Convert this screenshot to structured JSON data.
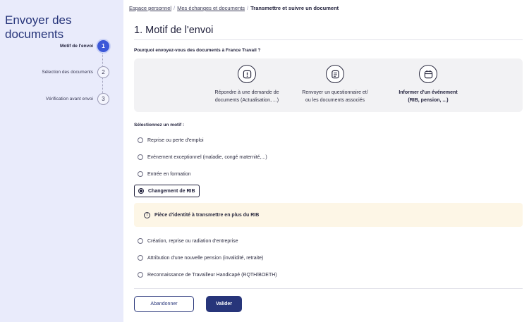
{
  "sidebar": {
    "title": "Envoyer des documents",
    "steps": [
      {
        "label": "Motif de l'envoi",
        "number": "1",
        "active": true
      },
      {
        "label": "Sélection des documents",
        "number": "2",
        "active": false
      },
      {
        "label": "Vérification avant envoi",
        "number": "3",
        "active": false
      }
    ]
  },
  "breadcrumb": {
    "items": [
      "Espace personnel",
      "Mes échanges et documents"
    ],
    "separator": "/",
    "current": "Transmettre et suivre un document"
  },
  "page": {
    "title": "1. Motif de l'envoi",
    "question": "Pourquoi envoyez-vous des documents à France Travail ?"
  },
  "cards": [
    {
      "icon": "alert-icon",
      "line1": "Répondre à une demande de",
      "line2": "documents (Actualisation, ...)",
      "selected": false
    },
    {
      "icon": "document-icon",
      "line1": "Renvoyer un questionnaire et/",
      "line2": "ou les documents associés",
      "selected": false
    },
    {
      "icon": "calendar-icon",
      "line1": "Informer d'un événement",
      "line2": "(RIB, pension, ...)",
      "selected": true
    }
  ],
  "motifs": {
    "label": "Sélectionnez un motif :",
    "options": [
      "Reprise ou perte d'emploi",
      "Evénement exceptionnel (maladie, congé maternité,...)",
      "Entrée en formation",
      "Changement de RIB",
      "Création, reprise ou radiation d'entreprise",
      "Attribution d'une nouvelle pension (invalidité, retraite)",
      "Reconnaissance de Travailleur Handicapé (RQTH/BOETH)"
    ],
    "selected": "Changement de RIB"
  },
  "warning": {
    "icon": "warning-icon",
    "text": "Pièce d'identité à transmettre en plus du RIB"
  },
  "actions": {
    "cancel_label": "Abandonner",
    "submit_label": "Valider"
  },
  "colors": {
    "sidebar_bg": "#e9ebfb",
    "accent": "#27357a",
    "active_step": "#3c58d8",
    "warning_bg": "#fdf6e6"
  }
}
